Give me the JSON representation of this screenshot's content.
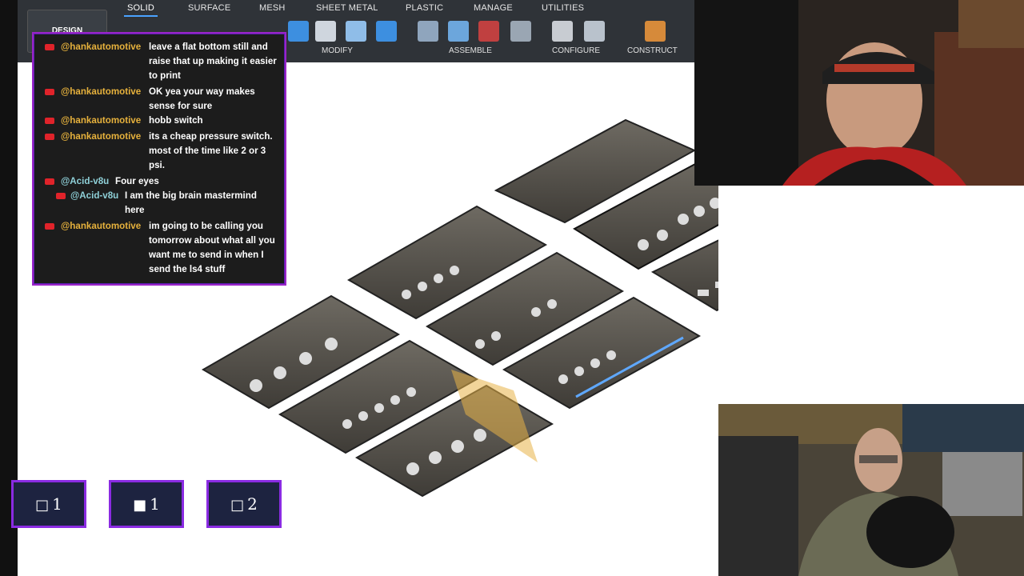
{
  "toolbar": {
    "tabs": [
      "SOLID",
      "SURFACE",
      "MESH",
      "SHEET METAL",
      "PLASTIC",
      "MANAGE",
      "UTILITIES"
    ],
    "active_tab": "SOLID",
    "design_label": "DESIGN",
    "groups": {
      "modify": "MODIFY",
      "assemble": "ASSEMBLE",
      "configure": "CONFIGURE",
      "construct": "CONSTRUCT"
    }
  },
  "chat": {
    "messages": [
      {
        "user": "@hankautomotive",
        "text": "leave a flat bottom still and raise that up making it easier to print"
      },
      {
        "user": "@hankautomotive",
        "text": "OK yea your way makes sense for sure"
      },
      {
        "user": "@hankautomotive",
        "text": "hobb switch"
      },
      {
        "user": "@hankautomotive",
        "text": "its a cheap pressure switch. most of the time like 2 or 3 psi."
      },
      {
        "user": "@Acid-v8u",
        "text": "Four eyes"
      },
      {
        "user": "@Acid-v8u",
        "text": "I am the big brain mastermind here"
      },
      {
        "user": "@hankautomotive",
        "text": "im going to be calling you tomorrow about what all you want me to send in when I send the ls4 stuff"
      }
    ]
  },
  "counters": [
    {
      "glyph": "□",
      "value": "1"
    },
    {
      "glyph": "■",
      "value": "1"
    },
    {
      "glyph": "□",
      "value": "2"
    }
  ],
  "colors": {
    "chat_border": "#9a24c8",
    "username": "#e6b13c",
    "username_alt": "#8fd0d8",
    "counter_border": "#8a2be2",
    "counter_bg": "#1d2340"
  }
}
